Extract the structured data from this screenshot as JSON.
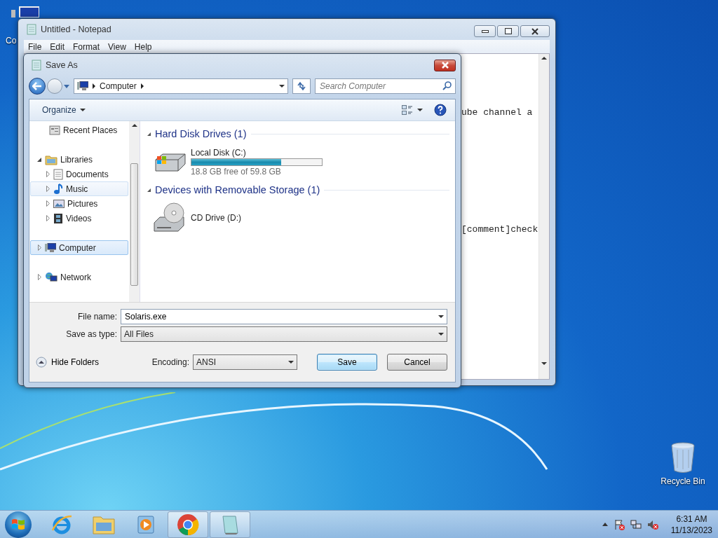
{
  "desktop_icons": [
    {
      "kind": "computer",
      "label": "Co"
    },
    {
      "kind": "recycle",
      "label": "Recycle Bin"
    }
  ],
  "notepad": {
    "title": "Untitled - Notepad",
    "menu": [
      "File",
      "Edit",
      "Format",
      "View",
      "Help"
    ],
    "lines": [
      "ube channel a",
      "[comment]check"
    ]
  },
  "dialog": {
    "title": "Save As",
    "address": "Computer",
    "search": {
      "placeholder": "Search Computer"
    },
    "toolbar": {
      "organize": "Organize"
    },
    "nav_tree": [
      {
        "kind": "recent",
        "label": "Recent Places",
        "selected": false,
        "hovered": false
      },
      {
        "kind": "libraries",
        "label": "Libraries",
        "expanded": true,
        "selected": false,
        "hovered": false,
        "children": [
          {
            "kind": "documents",
            "label": "Documents",
            "expanded": false,
            "selected": false,
            "hovered": false
          },
          {
            "kind": "music",
            "label": "Music",
            "expanded": false,
            "selected": false,
            "hovered": true
          },
          {
            "kind": "pictures",
            "label": "Pictures",
            "expanded": false,
            "selected": false,
            "hovered": false
          },
          {
            "kind": "videos",
            "label": "Videos",
            "expanded": false,
            "selected": false,
            "hovered": false
          }
        ]
      },
      {
        "kind": "computer",
        "label": "Computer",
        "expanded": false,
        "selected": true,
        "hovered": false
      },
      {
        "kind": "network",
        "label": "Network",
        "expanded": false,
        "selected": false,
        "hovered": false
      }
    ],
    "groups": [
      {
        "title": "Hard Disk Drives (1)",
        "expanded": true,
        "items": [
          {
            "kind": "hdd",
            "name": "Local Disk (C:)",
            "level": 0.686,
            "reading": "18.8 GB free of 59.8 GB"
          }
        ]
      },
      {
        "title": "Devices with Removable Storage (1)",
        "expanded": true,
        "items": [
          {
            "kind": "cd",
            "name": "CD Drive (D:)"
          }
        ]
      }
    ],
    "file_name": {
      "label": "File name:",
      "value": "Solaris.exe"
    },
    "save_as_type": {
      "label": "Save as type:",
      "value": "All Files"
    },
    "hide_folders": "Hide Folders",
    "encoding": {
      "label": "Encoding:",
      "value": "ANSI"
    },
    "buttons": [
      {
        "label": "Save",
        "default": true
      },
      {
        "label": "Cancel",
        "default": false
      }
    ]
  },
  "taskbar": {
    "apps": [
      {
        "kind": "ie",
        "open": false
      },
      {
        "kind": "explorer",
        "open": false
      },
      {
        "kind": "media",
        "open": false
      },
      {
        "kind": "chrome",
        "open": true
      },
      {
        "kind": "notepad",
        "open": true
      }
    ],
    "time": "6:31 AM",
    "date": "11/13/2023"
  }
}
